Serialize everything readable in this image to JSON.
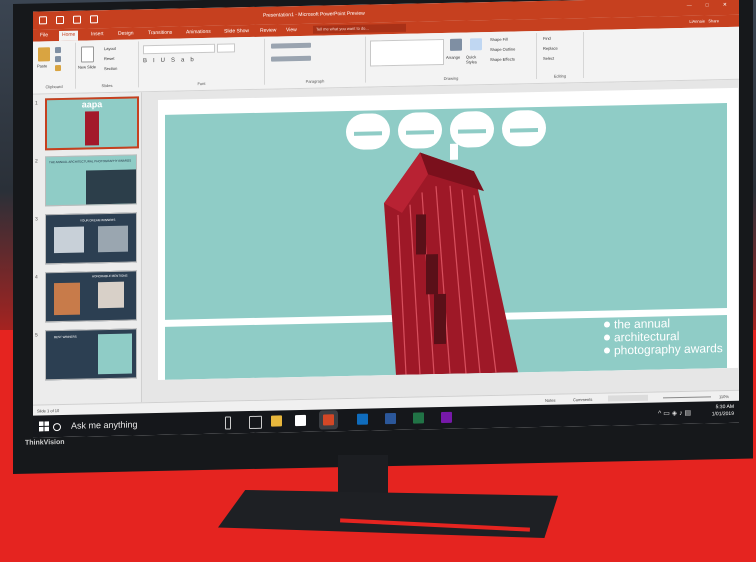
{
  "window": {
    "title": "Presentation1 - Microsoft PowerPoint Preview",
    "controls": [
      "—",
      "□",
      "✕"
    ]
  },
  "ribbon_tabs": [
    {
      "label": "File"
    },
    {
      "label": "Home"
    },
    {
      "label": "Insert"
    },
    {
      "label": "Design"
    },
    {
      "label": "Transitions"
    },
    {
      "label": "Animations"
    },
    {
      "label": "Slide Show"
    },
    {
      "label": "Review"
    },
    {
      "label": "View"
    }
  ],
  "tell_me": {
    "placeholder": "Tell me what you want to do..."
  },
  "account": {
    "name": "LiAnnaie",
    "share": "Share"
  },
  "ribbon": {
    "clipboard": {
      "label": "Clipboard",
      "paste": "Paste"
    },
    "slides": {
      "label": "Slides",
      "new_slide": "New Slide",
      "layout": "Layout",
      "reset": "Reset",
      "section": "Section"
    },
    "font": {
      "label": "Font"
    },
    "paragraph": {
      "label": "Paragraph"
    },
    "drawing": {
      "label": "Drawing",
      "arrange": "Arrange",
      "quick_styles": "Quick Styles",
      "shape_fill": "Shape Fill",
      "shape_outline": "Shape Outline",
      "shape_effects": "Shape Effects"
    },
    "editing": {
      "label": "Editing",
      "find": "Find",
      "replace": "Replace",
      "select": "Select"
    }
  },
  "thumbnails": [
    {
      "num": "1",
      "title": "aapa"
    },
    {
      "num": "2",
      "title": "THE ANNUAL ARCHITECTURAL PHOTOGRAPHY AWARDS"
    },
    {
      "num": "3",
      "title": "YOUR DREAM WINNERS"
    },
    {
      "num": "4",
      "title": "HONORABLE MENTIONS"
    },
    {
      "num": "5",
      "title": "BEST WINNERS"
    }
  ],
  "slide": {
    "logo": "aapa",
    "caption": [
      "the annual",
      "architectural",
      "photography awards"
    ]
  },
  "statusbar": {
    "slide_of": "Slide 1 of 10",
    "notes": "Notes",
    "comments": "Comments",
    "zoom": "110%"
  },
  "taskbar": {
    "search": "Ask me anything",
    "time": "5:30 AM",
    "date": "1/01/2019"
  },
  "brand": "ThinkVision",
  "colors": {
    "ppt_red": "#c6401f",
    "slide_teal": "#8fccc6",
    "building_red": "#a3192a",
    "bg_red": "#e52420"
  }
}
